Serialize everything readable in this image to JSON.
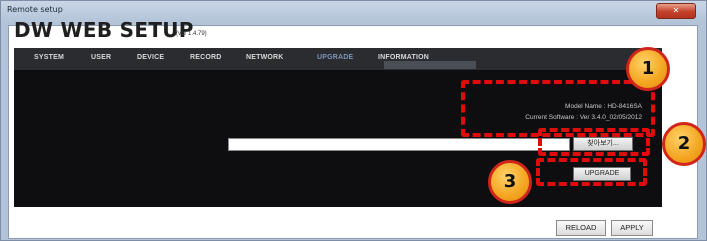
{
  "window": {
    "title": "Remote setup",
    "close_label": "Close"
  },
  "app": {
    "title": "DW WEB SETUP",
    "version": "(ver 1.4.79)"
  },
  "nav": {
    "tabs": [
      "SYSTEM",
      "USER",
      "DEVICE",
      "RECORD",
      "NETWORK",
      "UPGRADE",
      "INFORMATION"
    ],
    "active": "UPGRADE"
  },
  "upgrade": {
    "model_name": "Model Name : HD-8416SA",
    "current_software": "Current Software : Ver 3.4.0_02/05/2012",
    "file_path": "",
    "browse_label": "찾아보기...",
    "upgrade_label": "UPGRADE"
  },
  "footer": {
    "reload_label": "RELOAD",
    "apply_label": "APPLY"
  },
  "annotations": {
    "badge_1": "1",
    "badge_2": "2",
    "badge_3": "3",
    "highlight_color": "#e00b0b",
    "badge_color": "#f3a51f"
  }
}
